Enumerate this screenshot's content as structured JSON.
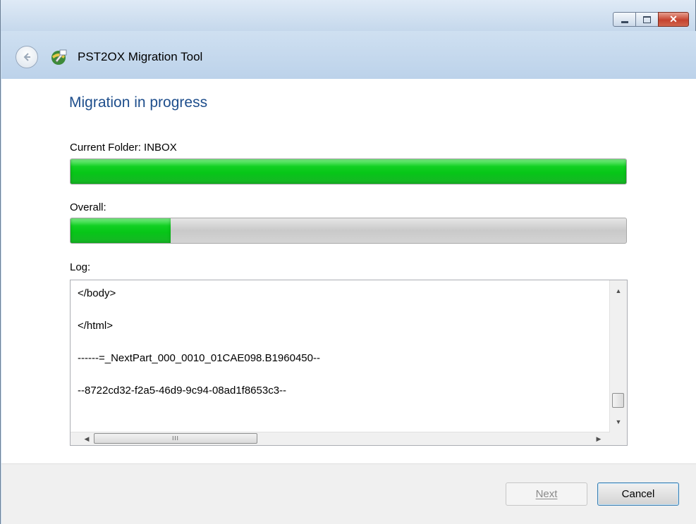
{
  "window": {
    "caption_buttons": {
      "minimize_icon": "minimize-icon",
      "maximize_icon": "maximize-icon",
      "close_glyph": "✕"
    }
  },
  "header": {
    "back_icon": "back-arrow-icon",
    "app_icon": "migration-app-icon",
    "title": "PST2OX Migration Tool"
  },
  "main": {
    "page_title": "Migration in progress",
    "current_folder_label": "Current Folder: INBOX",
    "current_folder_progress": 1.0,
    "overall_label": "Overall:",
    "overall_progress": 0.18,
    "progress_color": "#07c618",
    "log_label": "Log:",
    "log_lines": [
      "</body>",
      "</html>",
      "------=_NextPart_000_0010_01CAE098.B1960450--",
      "--8722cd32-f2a5-46d9-9c94-08ad1f8653c3--"
    ],
    "scroll_grip": "III"
  },
  "footer": {
    "next_label": "Next",
    "cancel_label": "Cancel"
  }
}
